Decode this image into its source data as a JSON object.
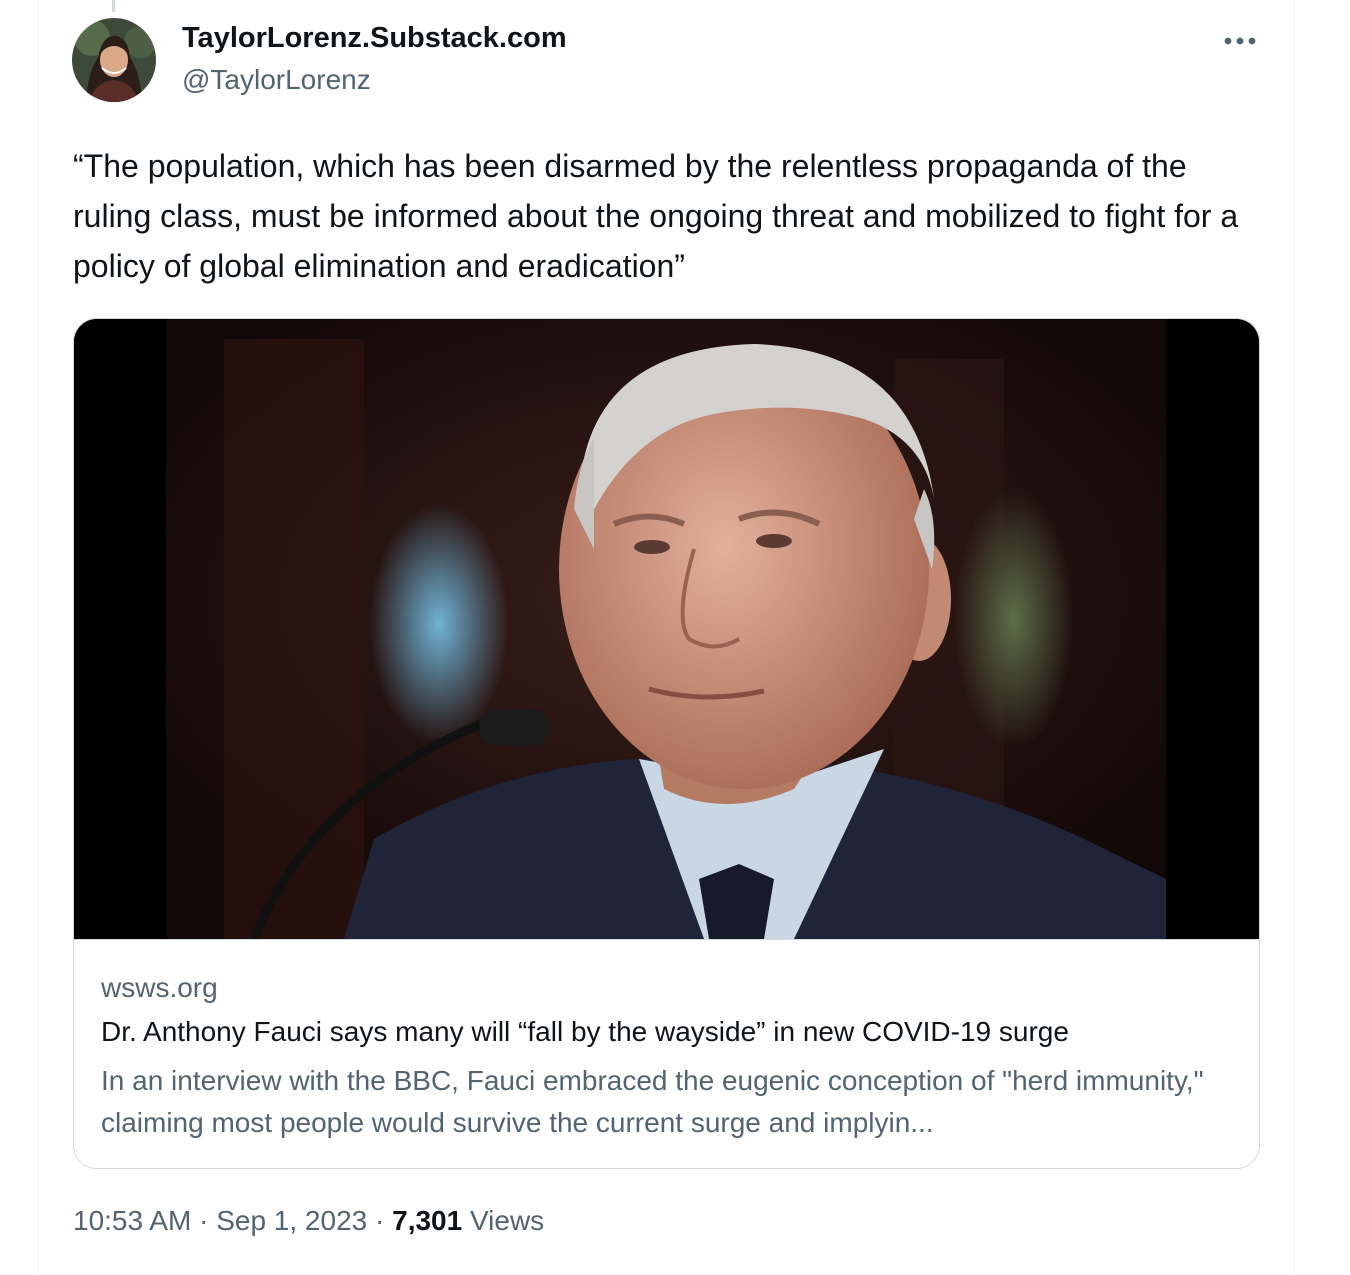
{
  "tweet": {
    "author": {
      "name": "TaylorLorenz.Substack.com",
      "handle": "@TaylorLorenz"
    },
    "more_icon": "more-horizontal-icon",
    "text": "“The population, which has been disarmed by the relentless propaganda of the ruling class, must be informed about the ongoing threat and mobilized to fight for a policy of global elimination and eradication”",
    "card": {
      "domain": "wsws.org",
      "title": "Dr. Anthony Fauci says many will “fall by the wayside” in new COVID-19 surge",
      "description": "In an interview with the BBC, Fauci embraced the eugenic conception of \"herd immunity,\" claiming most people would survive the current surge and implyin..."
    },
    "meta": {
      "time": "10:53 AM",
      "separator": "·",
      "date": "Sep 1, 2023",
      "views_count": "7,301",
      "views_label": "Views"
    }
  },
  "colors": {
    "primary_text": "#0f1419",
    "secondary_text": "#536471",
    "border": "#cfd9de"
  }
}
